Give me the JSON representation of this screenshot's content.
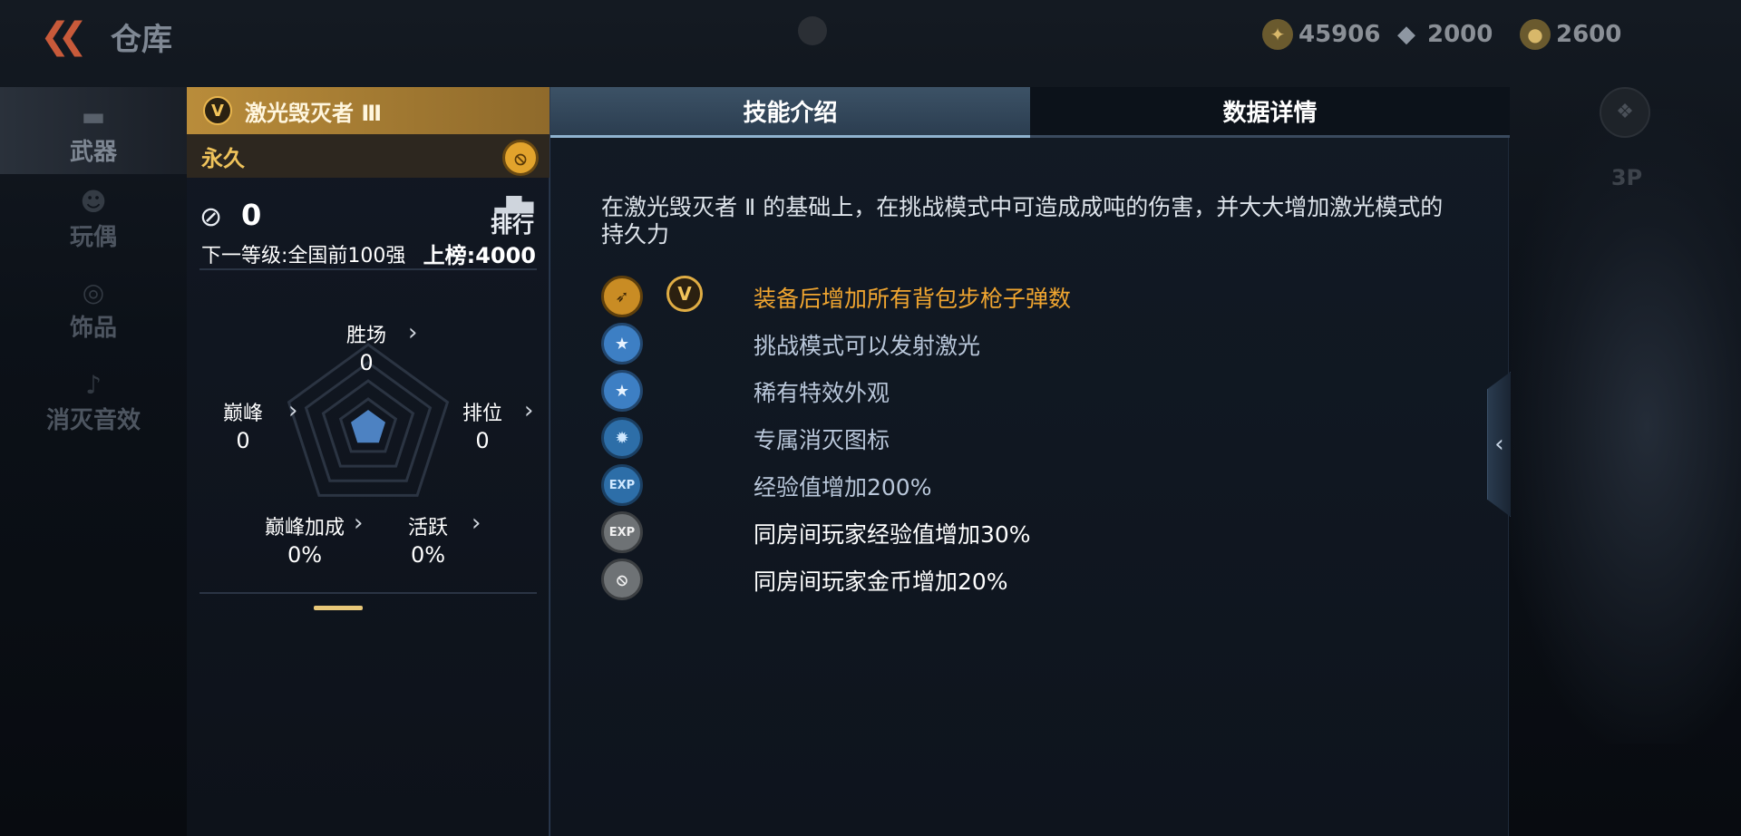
{
  "header": {
    "back_icon": "double-chevron-left",
    "title": "仓库",
    "resources": [
      {
        "icon": "coin-icon",
        "value": "45906"
      },
      {
        "icon": "diamond-icon",
        "value": "2000"
      },
      {
        "icon": "token-icon",
        "value": "2600"
      }
    ]
  },
  "left_nav": {
    "items": [
      {
        "label": "武器",
        "icon": "rifle-icon",
        "active": true
      },
      {
        "label": "玩偶",
        "icon": "doll-icon",
        "active": false
      },
      {
        "label": "饰品",
        "icon": "accessory-icon",
        "active": false
      },
      {
        "label": "消灭音效",
        "icon": "sound-icon",
        "active": false
      }
    ]
  },
  "right_ghost": {
    "view_label": "3P"
  },
  "card": {
    "name": "激光毁灭者 Ⅲ",
    "badge": "V",
    "duration": "永久",
    "kills": "0",
    "rank_label": "排行",
    "next_level": "下一等级:全国前100强",
    "board": "上榜:4000",
    "radar": {
      "wins": {
        "label": "胜场",
        "value": "0"
      },
      "peak": {
        "label": "巅峰",
        "value": "0"
      },
      "ranked": {
        "label": "排位",
        "value": "0"
      },
      "peak_bonus": {
        "label": "巅峰加成",
        "value": "0%"
      },
      "active": {
        "label": "活跃",
        "value": "0%"
      }
    }
  },
  "panel": {
    "tabs": [
      {
        "label": "技能介绍",
        "active": true
      },
      {
        "label": "数据详情",
        "active": false
      }
    ],
    "description": "在激光毁灭者 Ⅱ 的基础上，在挑战模式中可造成成吨的伤害，并大大增加激光模式的持久力",
    "skills": [
      {
        "icon": "rifle-ammo-icon",
        "style": "gold",
        "text": "装备后增加所有背包步枪子弹数",
        "badge": "V"
      },
      {
        "icon": "star-icon",
        "style": "blue",
        "text": "挑战模式可以发射激光"
      },
      {
        "icon": "star-icon",
        "style": "blue",
        "text": "稀有特效外观"
      },
      {
        "icon": "elimination-icon",
        "style": "teal",
        "text": "专属消灭图标"
      },
      {
        "icon": "exp-icon",
        "style": "teal",
        "text": "经验值增加200%"
      },
      {
        "icon": "exp-room-icon",
        "style": "grey",
        "text": "同房间玩家经验值增加30%"
      },
      {
        "icon": "coin-room-icon",
        "style": "grey",
        "text": "同房间玩家金币增加20%"
      }
    ]
  },
  "colors": {
    "gold": "#f0a530",
    "skill_blue_text": "#b9c7da",
    "tab_active": "#3c5266",
    "card_header": "#b98c3a"
  }
}
